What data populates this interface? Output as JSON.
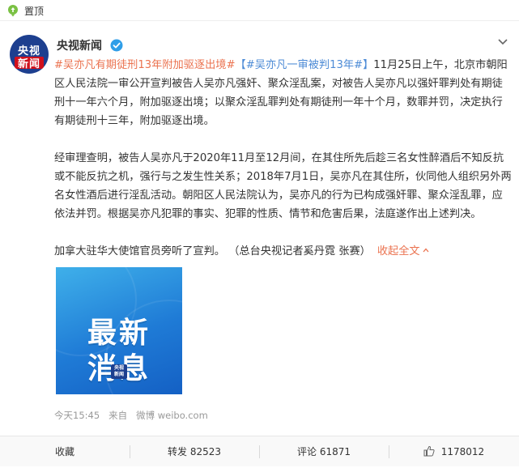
{
  "pin": {
    "label": "置顶"
  },
  "author": {
    "name": "央视新闻",
    "avatar_text_top": "央视",
    "avatar_text_bottom": "新闻",
    "verified": true
  },
  "post": {
    "hashtags": [
      "#吴亦凡有期徒刑13年附加驱逐出境#",
      "【#吴亦凡一审被判13年#】"
    ],
    "paragraph1_tail": "11月25日上午，北京市朝阳区人民法院一审公开宣判被告人吴亦凡强奸、聚众淫乱案，对被告人吴亦凡以强奸罪判处有期徒刑十一年六个月，附加驱逐出境；以聚众淫乱罪判处有期徒刑一年十个月，数罪并罚，决定执行有期徒刑十三年，附加驱逐出境。",
    "paragraph2": "经审理查明，被告人吴亦凡于2020年11月至12月间，在其住所先后趁三名女性醉酒后不知反抗或不能反抗之机，强行与之发生性关系；2018年7月1日，吴亦凡在其住所，伙同他人组织另外两名女性酒后进行淫乱活动。朝阳区人民法院认为，吴亦凡的行为已构成强奸罪、聚众淫乱罪，应依法并罚。根据吴亦凡犯罪的事实、犯罪的性质、情节和危害后果，法庭遂作出上述判决。",
    "paragraph3": "加拿大驻华大使馆官员旁听了宣判。 （总台央视记者奚丹霓 张赛）",
    "fold_label": "收起全文"
  },
  "image": {
    "line1": "最新",
    "line2": "消息",
    "logo_top": "央视",
    "logo_bottom": "新闻"
  },
  "meta": {
    "time": "今天15:45",
    "from_label": "来自",
    "source": "微博 weibo.com"
  },
  "actions": {
    "collect": "收藏",
    "repost_label": "转发",
    "repost_count": "82523",
    "comment_label": "评论",
    "comment_count": "61871",
    "like_count": "1178012"
  },
  "colors": {
    "hashtag_orange": "#eb7350",
    "hashtag_blue": "#4d8bd6",
    "pin_green": "#7ac143",
    "verify_blue": "#2f9ee8",
    "avatar_blue": "#1d3f8f",
    "avatar_red": "#d0101c"
  },
  "icons": [
    "pin-icon",
    "verified-icon",
    "more-chevron-icon",
    "chevron-up-icon",
    "thumbs-up-icon"
  ]
}
